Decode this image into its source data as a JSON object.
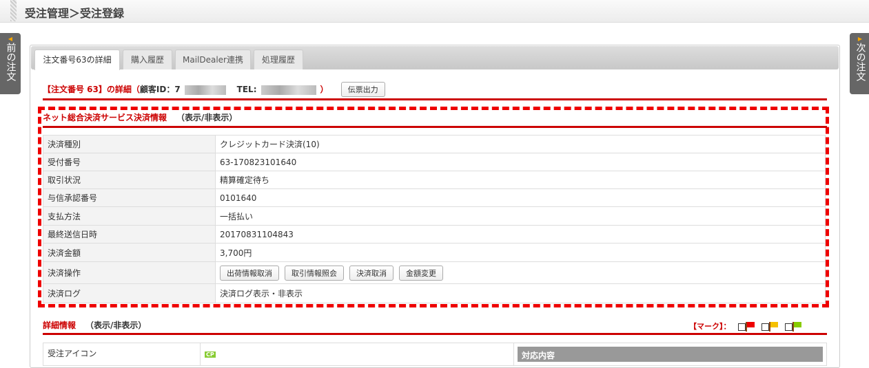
{
  "header": {
    "title": "受注管理＞受注登録"
  },
  "nav": {
    "prev": "前の注文",
    "next": "次の注文"
  },
  "tabs": [
    "注文番号63の詳細",
    "購入履歴",
    "MailDealer連携",
    "処理履歴"
  ],
  "order": {
    "title": "【注文番号 63】の詳細（",
    "customer_label": "顧客ID：7",
    "tel_label": "TEL:",
    "close": "）",
    "print_button": "伝票出力"
  },
  "payment": {
    "heading": "ネット総合決済サービス決済情報",
    "toggle": "（表示/非表示）",
    "rows": [
      {
        "label": "決済種別",
        "value": "クレジットカード決済(10)"
      },
      {
        "label": "受付番号",
        "value": "63-170823101640"
      },
      {
        "label": "取引状況",
        "value": "精算確定待ち"
      },
      {
        "label": "与信承認番号",
        "value": "0101640"
      },
      {
        "label": "支払方法",
        "value": "一括払い"
      },
      {
        "label": "最終送信日時",
        "value": "20170831104843"
      },
      {
        "label": "決済金額",
        "value": "3,700円"
      }
    ],
    "ops_label": "決済操作",
    "ops": [
      "出荷情報取消",
      "取引情報照会",
      "決済取消",
      "金額変更"
    ],
    "log_label": "決済ログ",
    "log_value": "決済ログ表示・非表示"
  },
  "detail": {
    "heading": "詳細情報",
    "toggle": "（表示/非表示）",
    "mark_label": "【マーク】：",
    "icon_label": "受注アイコン",
    "icon_badge": "CP",
    "response_header": "対応内容"
  },
  "flag_colors": [
    "#e00",
    "#f5c000",
    "#8c0"
  ]
}
